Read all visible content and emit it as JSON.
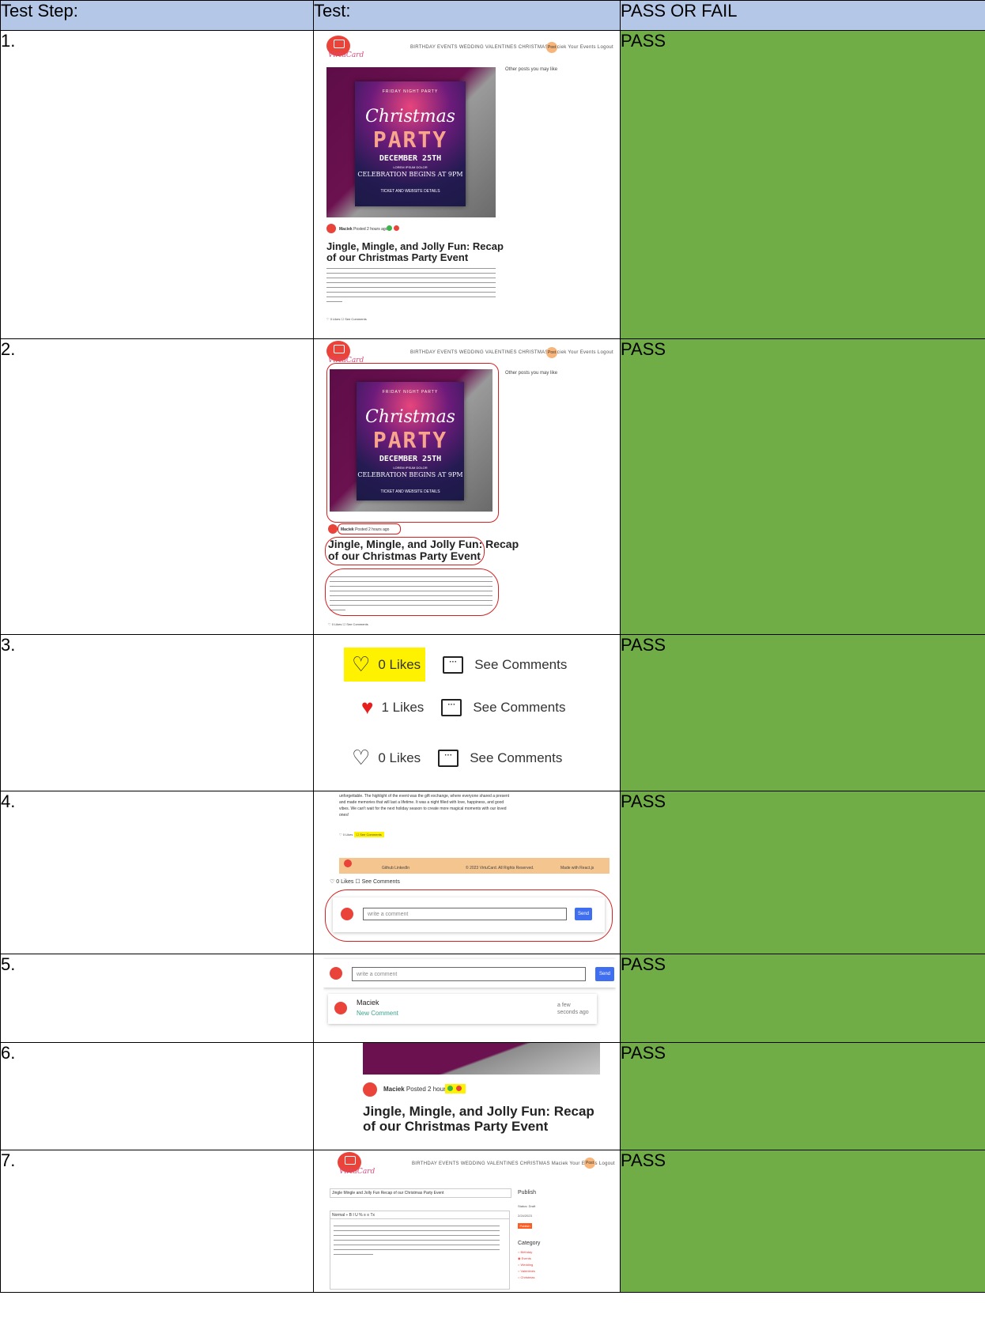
{
  "headers": {
    "step": "Test Step:",
    "test": "Test:",
    "result": "PASS OR FAIL"
  },
  "rows": [
    {
      "step": "1.",
      "result": "PASS"
    },
    {
      "step": "2.",
      "result": "PASS"
    },
    {
      "step": "3.",
      "result": "PASS"
    },
    {
      "step": "4.",
      "result": "PASS"
    },
    {
      "step": "5.",
      "result": "PASS"
    },
    {
      "step": "6.",
      "result": "PASS"
    },
    {
      "step": "7.",
      "result": "PASS"
    }
  ],
  "site": {
    "logo_text": "VirtuCard",
    "nav": "BIRTHDAY  EVENTS  WEDDING  VALENTINES  CHRISTMAS  Maciek  Your Events  Logout",
    "post_button": "Post",
    "other_posts": "Other posts you may like"
  },
  "poster": {
    "top": "FRIDAY NIGHT PARTY",
    "script": "Christmas",
    "party": "PARTY",
    "date": "DECEMBER 25TH",
    "lorem": "LOREM IPSUM DOLOR",
    "celebration": "CELEBRATION BEGINS AT 9PM",
    "ticket": "TICKET AND WEBSITE DETAILS"
  },
  "post": {
    "author": "Maciek",
    "posted": "Posted 2 hours ago",
    "title_line1": "Jingle, Mingle, and Jolly Fun: Recap",
    "title_line2": "of our Christmas Party Event",
    "likes_mini": "0 Likes",
    "comments_mini": "See Comments"
  },
  "likes_demo": [
    {
      "label": "0 Likes",
      "comments": "See Comments",
      "liked": false
    },
    {
      "label": "1 Likes",
      "comments": "See Comments",
      "liked": true
    },
    {
      "label": "0 Likes",
      "comments": "See Comments",
      "liked": false
    }
  ],
  "step4": {
    "text1": "unforgettable. The highlight of the event was the gift exchange, where everyone shared a present",
    "text2": "and made memories that will last a lifetime. It was a night filled with love, happiness, and good",
    "text3": "vibes. We can't wait for the next holiday season to create more magical moments with our loved",
    "text4": "ones!",
    "footer_links": "Github   LinkedIn",
    "footer_copy": "© 2023 VirtuCard. All Rights Reserved.",
    "footer_made": "Made with React.js",
    "likes": "0 Likes",
    "comments": "See Comments",
    "placeholder": "write a comment",
    "send": "Send"
  },
  "step5": {
    "placeholder": "write a comment",
    "send": "Send",
    "author": "Maciek",
    "comment": "New Comment",
    "time": "a few seconds ago"
  },
  "step6": {
    "author": "Maciek",
    "posted": "Posted 2 hours ago",
    "title_line1": "Jingle, Mingle, and Jolly Fun: Recap",
    "title_line2": "of our Christmas Party Event"
  },
  "step7": {
    "title": "Jingle Mingle and Jolly Fun Recap of our Christmas Party Event",
    "toolbar": "Normal   ÷   B  I  U  %   ≡  ≡   Tx",
    "publish": "Publish",
    "status": "Status: Draft",
    "date": "2/24/2023",
    "publish_btn": "Publish",
    "category": "Category",
    "categories": [
      "Birthday",
      "Events",
      "Wedding",
      "Valentines",
      "Christmas"
    ]
  }
}
